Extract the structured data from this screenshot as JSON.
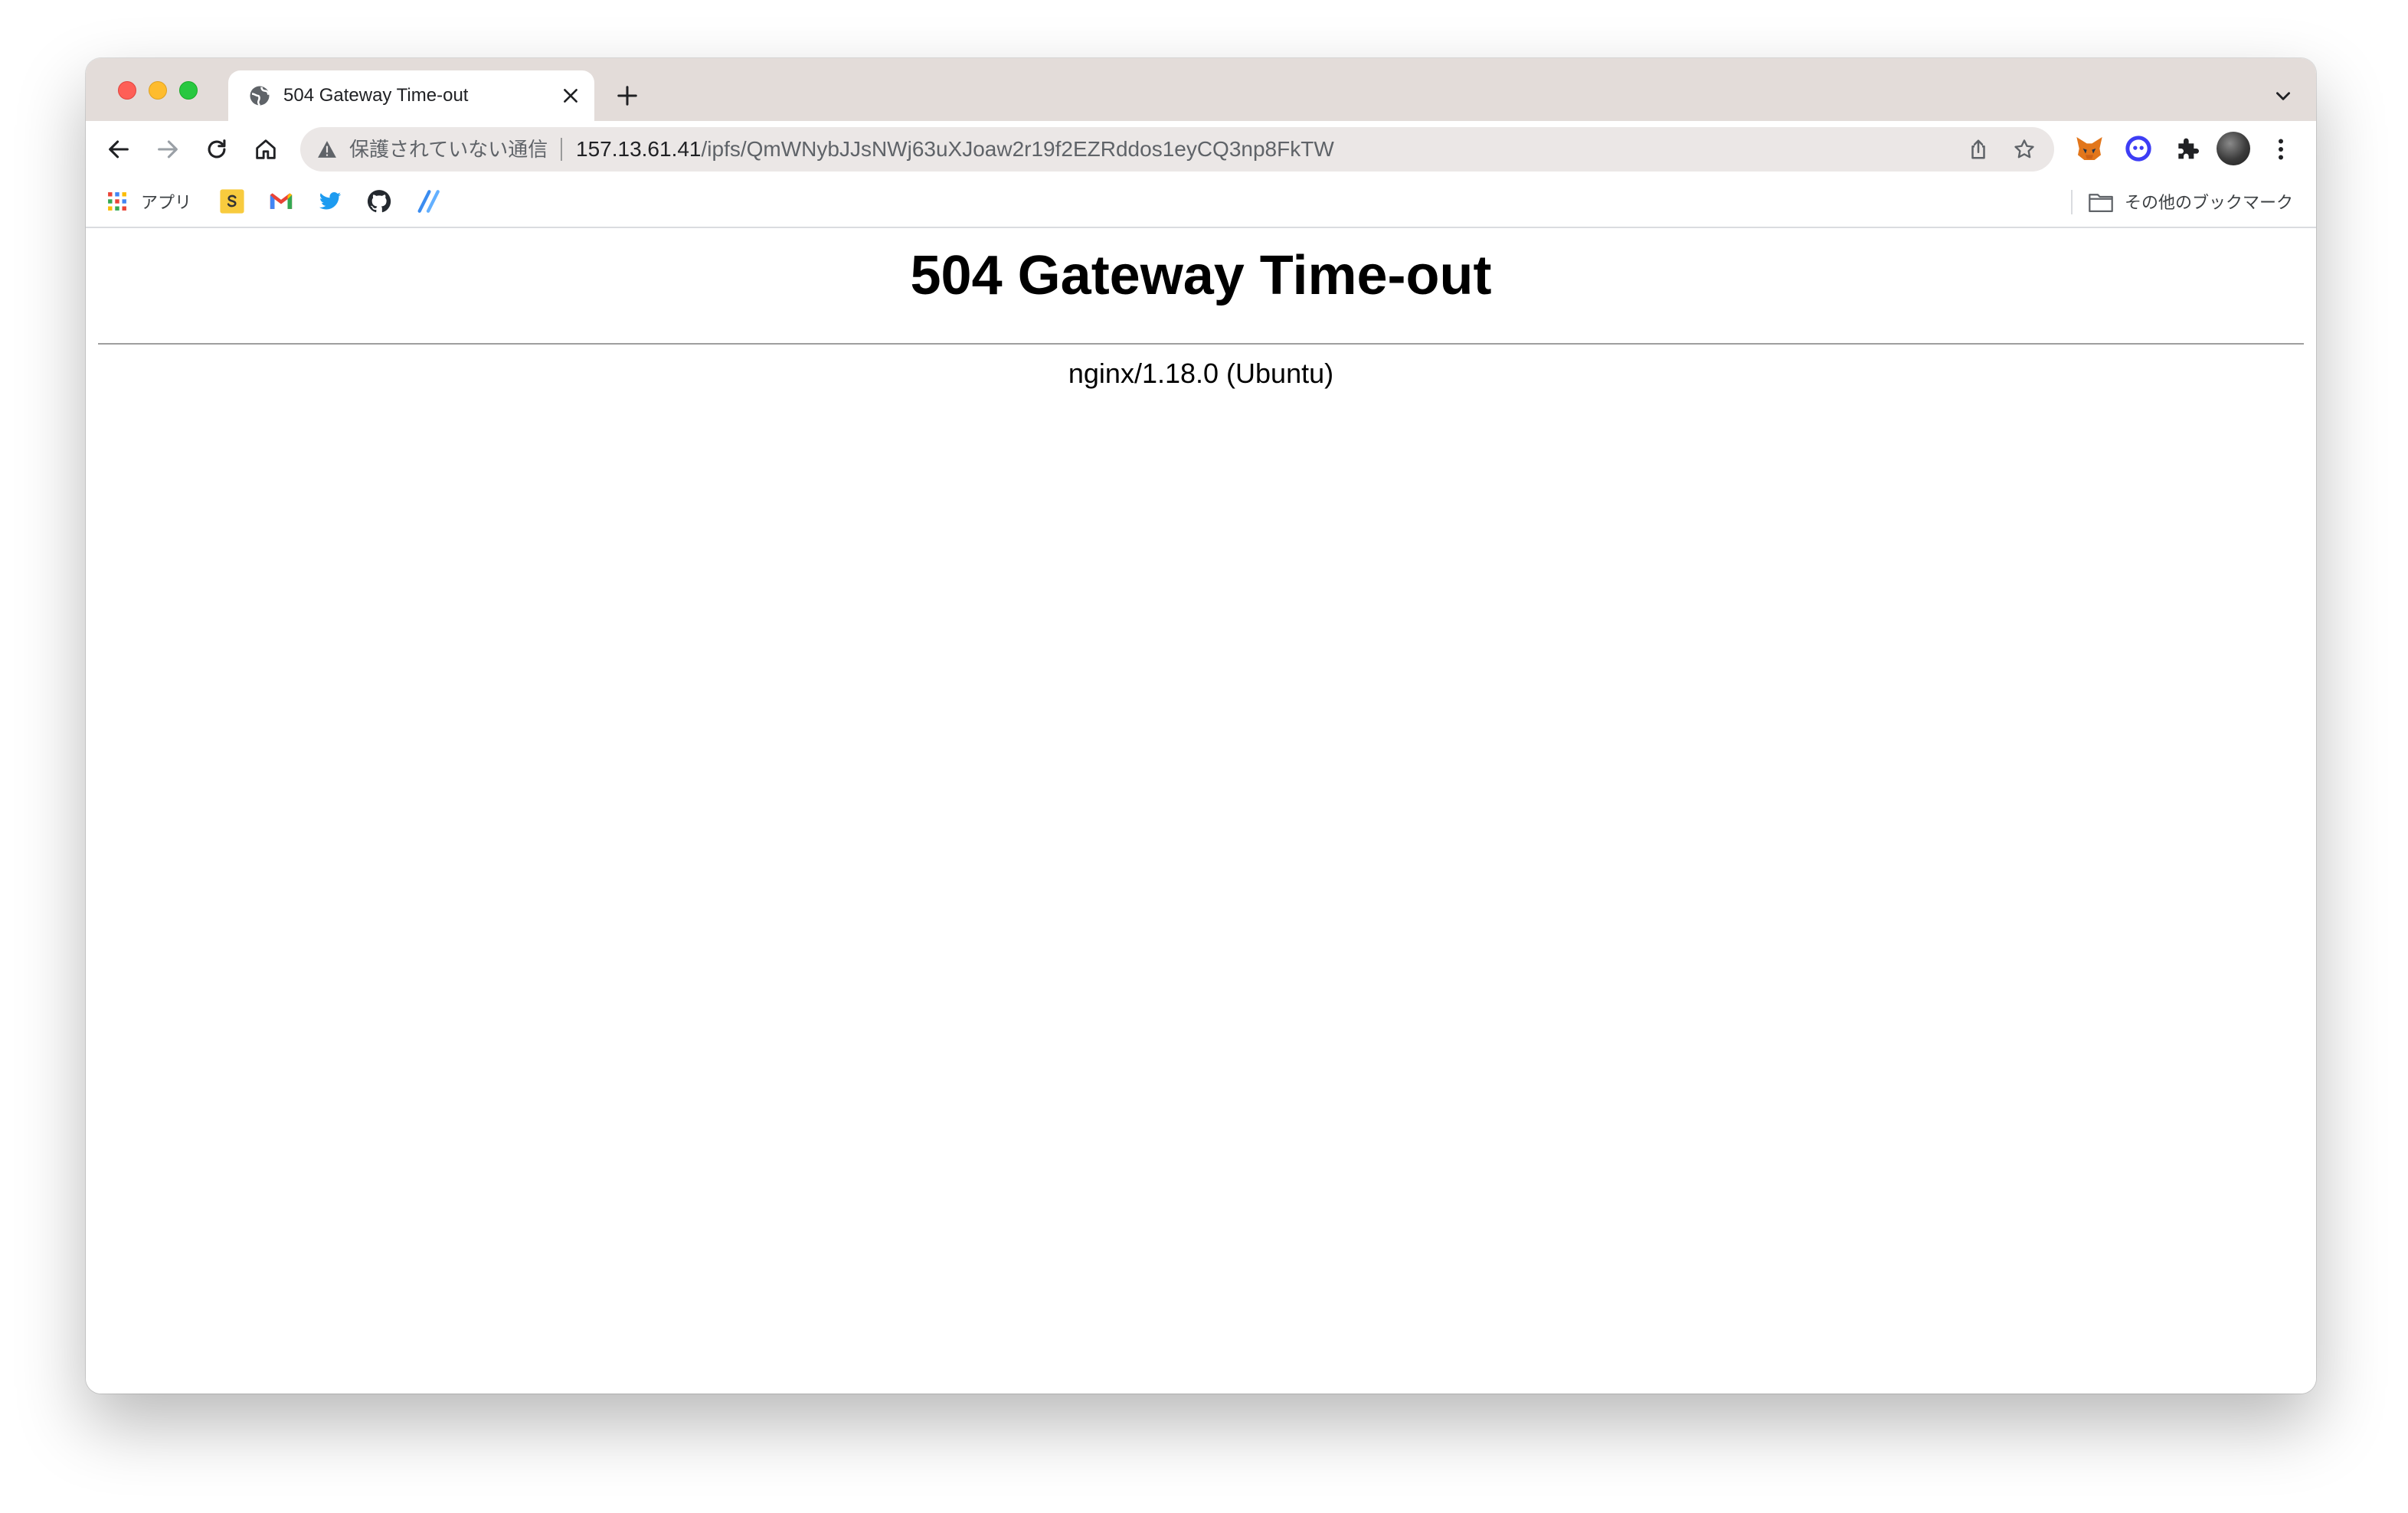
{
  "browser": {
    "tab": {
      "title": "504 Gateway Time-out"
    },
    "omnibox": {
      "security_label": "保護されていない通信",
      "url_host": "157.13.61.41",
      "url_path": "/ipfs/QmWNybJJsNWj63uXJoaw2r19f2EZRddos1eyCQ3np8FkTW"
    },
    "bookmarks": {
      "apps_label": "アプリ",
      "other_bookmarks_label": "その他のブックマーク"
    },
    "colors": {
      "tabstrip": "#e3dcd9",
      "omnibox": "#ebe7e6"
    }
  },
  "page": {
    "title": "504 Gateway Time-out",
    "server": "nginx/1.18.0 (Ubuntu)"
  }
}
